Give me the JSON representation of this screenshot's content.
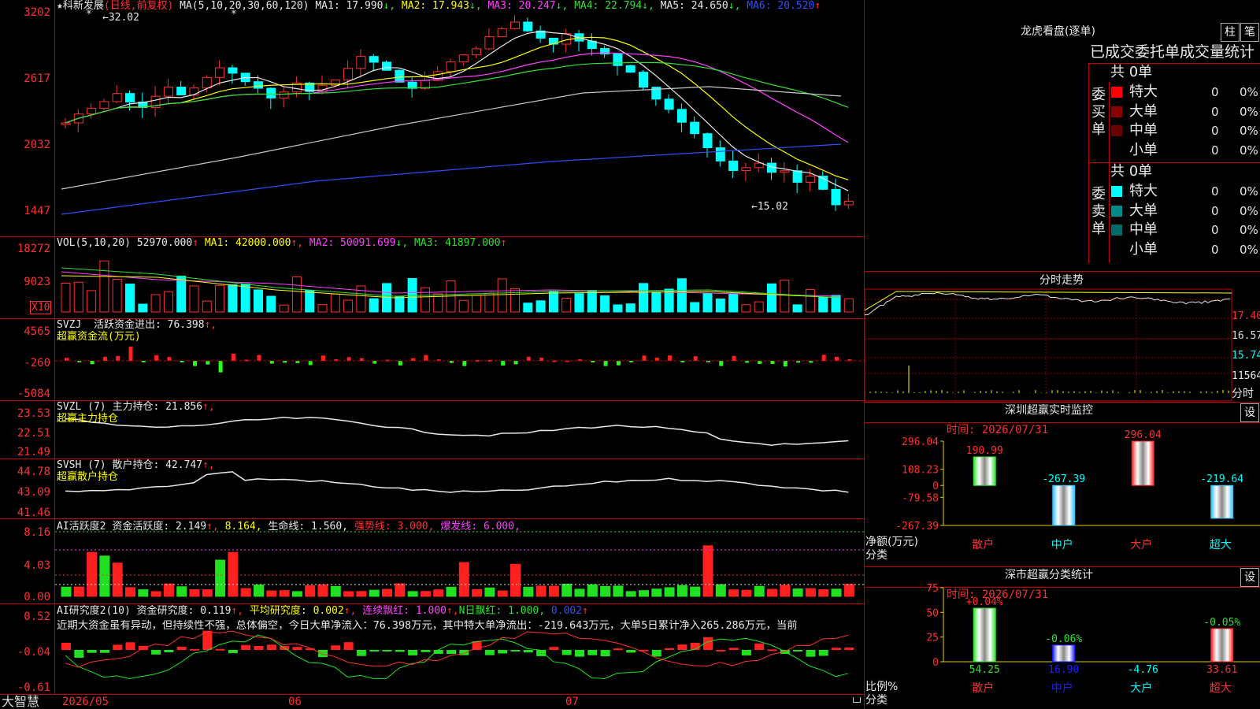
{
  "main": {
    "title": "★科新发展",
    "period": "(日线,前复权)",
    "ma_label": "MA(5,10,20,30,60,120)",
    "ma": [
      {
        "name": "MA1",
        "value": "17.990",
        "arrow": "↓",
        "color": "#e8e8e8"
      },
      {
        "name": "MA2",
        "value": "17.943",
        "arrow": "↓",
        "color": "#ffff00"
      },
      {
        "name": "MA3",
        "value": "20.247",
        "arrow": "↓",
        "color": "#ff40ff"
      },
      {
        "name": "MA4",
        "value": "22.794",
        "arrow": "↓",
        "color": "#30e030"
      },
      {
        "name": "MA5",
        "value": "24.650",
        "arrow": "↓",
        "color": "#e8e8e8"
      },
      {
        "name": "MA6",
        "value": "20.520",
        "arrow": "↑",
        "color": "#3050ff"
      }
    ],
    "y_ticks": [
      "3202",
      "2617",
      "2032",
      "1447"
    ],
    "high_label": "←32.02",
    "low_label": "←15.02",
    "star": "*"
  },
  "vol": {
    "label": "VOL(5,10,20)",
    "value": "52970.000",
    "arrow": "↑",
    "ma": [
      {
        "name": "MA1",
        "value": "42000.000",
        "arrow": "↑",
        "color": "#ffff00"
      },
      {
        "name": "MA2",
        "value": "50091.699",
        "arrow": "↓",
        "color": "#ff40ff"
      },
      {
        "name": "MA3",
        "value": "41897.000",
        "arrow": "↑",
        "color": "#30e030"
      }
    ],
    "y_ticks": [
      "18272",
      "9023"
    ],
    "unit": "X10"
  },
  "svzj": {
    "label": "SVZJ",
    "desc": "活跃资金进出:",
    "value": "76.398",
    "arrow": "↑,",
    "sub": "超赢资金流(万元)",
    "y_ticks": [
      "4565",
      "-260",
      "-5084"
    ]
  },
  "svzl": {
    "label": "SVZL  (7)",
    "desc": "主力持仓:",
    "value": "21.856",
    "arrow": "↑,",
    "sub": "超赢主力持仓",
    "y_ticks": [
      "23.53",
      "22.51",
      "21.49"
    ]
  },
  "svsh": {
    "label": "SVSH  (7)",
    "desc": "散户持仓:",
    "value": "42.747",
    "arrow": "↑,",
    "sub": "超赢散户持仓",
    "y_ticks": [
      "44.78",
      "43.09",
      "41.46"
    ]
  },
  "ai1": {
    "label": "AI活跃度2",
    "desc": "资金活跃度:",
    "value": "2.149",
    "arrow": "↑,",
    "v2": "8.164,",
    "life": "生命线:",
    "life_v": "1.560,",
    "strong": "强势线:",
    "strong_v": "3.000,",
    "burst": "爆发线:",
    "burst_v": "6.000,",
    "y_ticks": [
      "8.16",
      "4.03",
      "0.00"
    ]
  },
  "ai2": {
    "label": "AI研究度2(10)",
    "desc": "资金研究度:",
    "value": "0.119",
    "avg": "平均研究度:",
    "avg_v": "0.002",
    "cont": "连续飘红:",
    "cont_v": "1.000",
    "nday": "N日飘红:",
    "nday_v": "1.000,",
    "last_v": "0.002",
    "comment": "近期大资金虽有异动，但持续性不强，总体偏空，今日大单净流入：76.398万元，其中特大单净流出：-219.643万元，大单5日累计净入265.286万元，当前",
    "y_ticks": [
      "0.52",
      "-0.04",
      "-0.61"
    ]
  },
  "dates": [
    "2026/05",
    "06",
    "07"
  ],
  "brand": "大智慧",
  "lhb": {
    "title": "龙虎看盘(逐单)",
    "btn1": "柱",
    "btn2": "笔",
    "subtitle": "已成交委托单成交量统计",
    "buy_label": "委买单",
    "sell_label": "委卖单",
    "buy_total": "共 0单",
    "sell_total": "共 0单",
    "buy_rows": [
      {
        "name": "特大",
        "count": "0",
        "pct": "0%",
        "color": "#ff0000"
      },
      {
        "name": "大单",
        "count": "0",
        "pct": "0%",
        "color": "#8b0000"
      },
      {
        "name": "中单",
        "count": "0",
        "pct": "0%",
        "color": "#6a0000"
      },
      {
        "name": "小单",
        "count": "0",
        "pct": "0%",
        "color": "#000000"
      }
    ],
    "sell_rows": [
      {
        "name": "特大",
        "count": "0",
        "pct": "0%",
        "color": "#00ffff"
      },
      {
        "name": "大单",
        "count": "0",
        "pct": "0%",
        "color": "#008b8b"
      },
      {
        "name": "中单",
        "count": "0",
        "pct": "0%",
        "color": "#006a6a"
      },
      {
        "name": "小单",
        "count": "0",
        "pct": "0%",
        "color": "#000000"
      }
    ]
  },
  "intraday": {
    "title": "分时走势",
    "p1": "17.40",
    "p2": "16.57",
    "p3": "15.74",
    "vol": "11564",
    "vol_label": "分时"
  },
  "sz_monitor": {
    "title": "深圳超赢实时监控",
    "btn": "设",
    "time": "时间: 2026/07/31",
    "y_ticks": [
      "296.04",
      "108.23",
      "0",
      "-79.58",
      "-267.39"
    ],
    "y_label1": "净额(万元)",
    "y_label2": "分类",
    "categories": [
      "散户",
      "中户",
      "大户",
      "超大"
    ],
    "values": [
      190.99,
      -267.39,
      296.04,
      -219.64
    ],
    "value_labels": [
      "190.99",
      "-267.39",
      "296.04",
      "-219.64"
    ]
  },
  "sz_class": {
    "title": "深市超赢分类统计",
    "btn": "设",
    "time": "时间: 2026/07/31",
    "y_ticks": [
      "75",
      "50",
      "25",
      "0"
    ],
    "y_label1": "比例%",
    "y_label2": "分类",
    "categories": [
      "散户",
      "中户",
      "大户",
      "超大"
    ],
    "values": [
      54.25,
      16.9,
      -4.76,
      33.61
    ],
    "value_labels": [
      "54.25",
      "16.90",
      "-4.76",
      "33.61"
    ],
    "change_labels": [
      "+0.04%",
      "-0.06%",
      "",
      "-0.05%"
    ]
  },
  "chart_data": [
    {
      "type": "bar",
      "title": "深圳超赢实时监控",
      "ylabel": "净额(万元)",
      "xlabel": "分类",
      "categories": [
        "散户",
        "中户",
        "大户",
        "超大"
      ],
      "values": [
        190.99,
        -267.39,
        296.04,
        -219.64
      ],
      "ylim": [
        -267.39,
        296.04
      ]
    },
    {
      "type": "bar",
      "title": "深市超赢分类统计",
      "ylabel": "比例%",
      "xlabel": "分类",
      "categories": [
        "散户",
        "中户",
        "大户",
        "超大"
      ],
      "values": [
        54.25,
        16.9,
        -4.76,
        33.61
      ],
      "ylim": [
        0,
        75
      ]
    }
  ]
}
